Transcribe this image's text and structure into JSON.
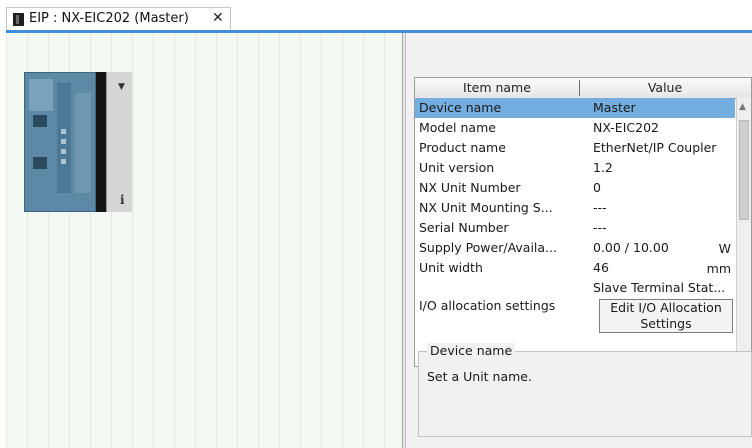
{
  "tab": {
    "title": "EIP : NX-EIC202 (Master)",
    "close_glyph": "✕",
    "icon": "device-icon"
  },
  "canvas": {
    "device_dropdown_glyph": "▼",
    "device_info_glyph": "i"
  },
  "properties": {
    "header_name": "Item name",
    "header_value": "Value",
    "rows": [
      {
        "name": "Device name",
        "value": "Master",
        "unit": "",
        "selected": true
      },
      {
        "name": "Model name",
        "value": "NX-EIC202",
        "unit": ""
      },
      {
        "name": "Product name",
        "value": "EtherNet/IP Coupler",
        "unit": ""
      },
      {
        "name": "Unit version",
        "value": "1.2",
        "unit": ""
      },
      {
        "name": "NX Unit Number",
        "value": "0",
        "unit": ""
      },
      {
        "name": "NX Unit Mounting S...",
        "value": "---",
        "unit": ""
      },
      {
        "name": "Serial Number",
        "value": "---",
        "unit": ""
      },
      {
        "name": "Supply Power/Availa...",
        "value": "0.00 / 10.00",
        "unit": "W"
      },
      {
        "name": "Unit width",
        "value": "46",
        "unit": "mm"
      }
    ],
    "io_row": {
      "value": "Slave Terminal Stat...",
      "name": "I/O allocation settings",
      "button_line1": "Edit I/O Allocation",
      "button_line2": "Settings"
    },
    "scroll_up_glyph": "▲",
    "scroll_down_glyph": "▼"
  },
  "description": {
    "legend": "Device name",
    "text": "Set a Unit name."
  },
  "colors": {
    "selection": "#74aee0",
    "tab_accent": "#3d8fd6"
  }
}
